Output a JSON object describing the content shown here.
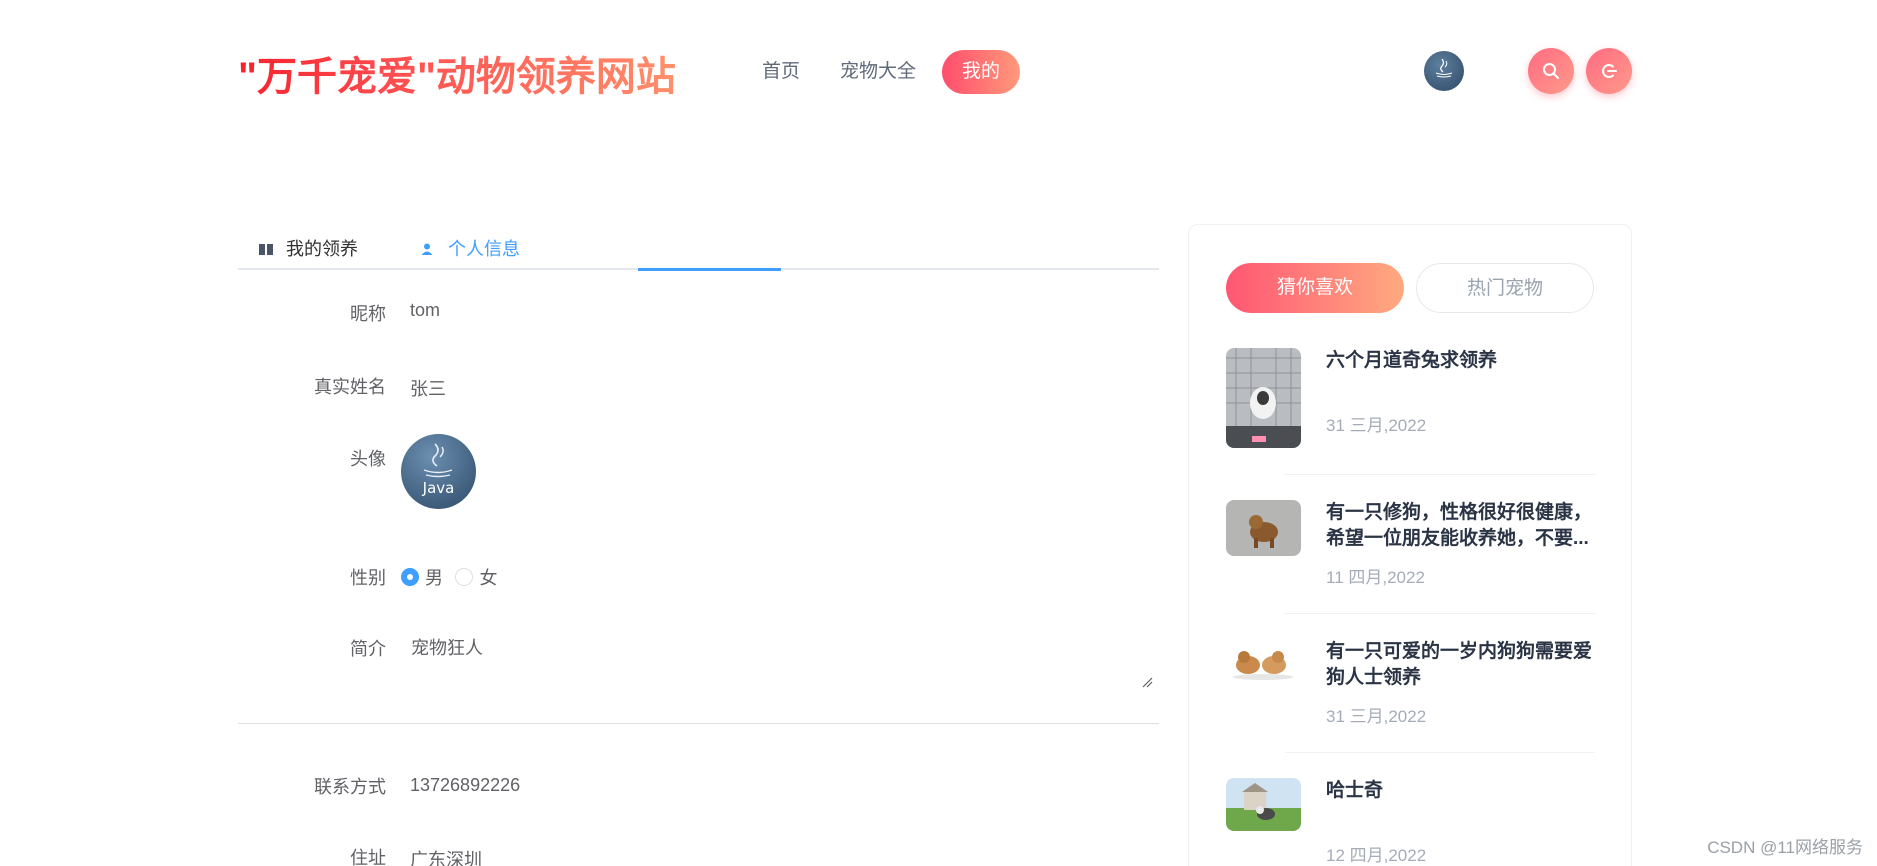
{
  "header": {
    "logo": "\"万千宠爱\"动物领养网站",
    "nav": [
      "首页",
      "宠物大全",
      "我的"
    ],
    "active_nav": "我的"
  },
  "tabs": [
    "我的领养",
    "个人信息"
  ],
  "active_tab": "个人信息",
  "form": {
    "nickname_label": "昵称",
    "nickname": "tom",
    "realname_label": "真实姓名",
    "realname": "张三",
    "avatar_label": "头像",
    "avatar_text": "Java",
    "gender_label": "性别",
    "gender_male": "男",
    "gender_female": "女",
    "gender_selected": "男",
    "intro_label": "简介",
    "intro": "宠物狂人",
    "contact_label": "联系方式",
    "contact": "13726892226",
    "address_label": "住址",
    "address": "广东深圳"
  },
  "sidebar": {
    "tabs": [
      "猜你喜欢",
      "热门宠物"
    ],
    "active_tab": "猜你喜欢",
    "items": [
      {
        "title": "六个月道奇兔求领养",
        "date": "31 三月,2022"
      },
      {
        "title": "有一只修狗，性格很好很健康，希望一位朋友能收养她，不要...",
        "date": "11 四月,2022"
      },
      {
        "title": "有一只可爱的一岁内狗狗需要爱狗人士领养",
        "date": "31 三月,2022"
      },
      {
        "title": "哈士奇",
        "date": "12 四月,2022"
      }
    ]
  },
  "watermark": "CSDN @11网络服务",
  "colors": {
    "accent_gradient_start": "#ff4d6d",
    "accent_gradient_end": "#ff9a7a",
    "tab_active": "#409eff",
    "title_text": "#2b3445",
    "date_text": "#a5acb8"
  }
}
